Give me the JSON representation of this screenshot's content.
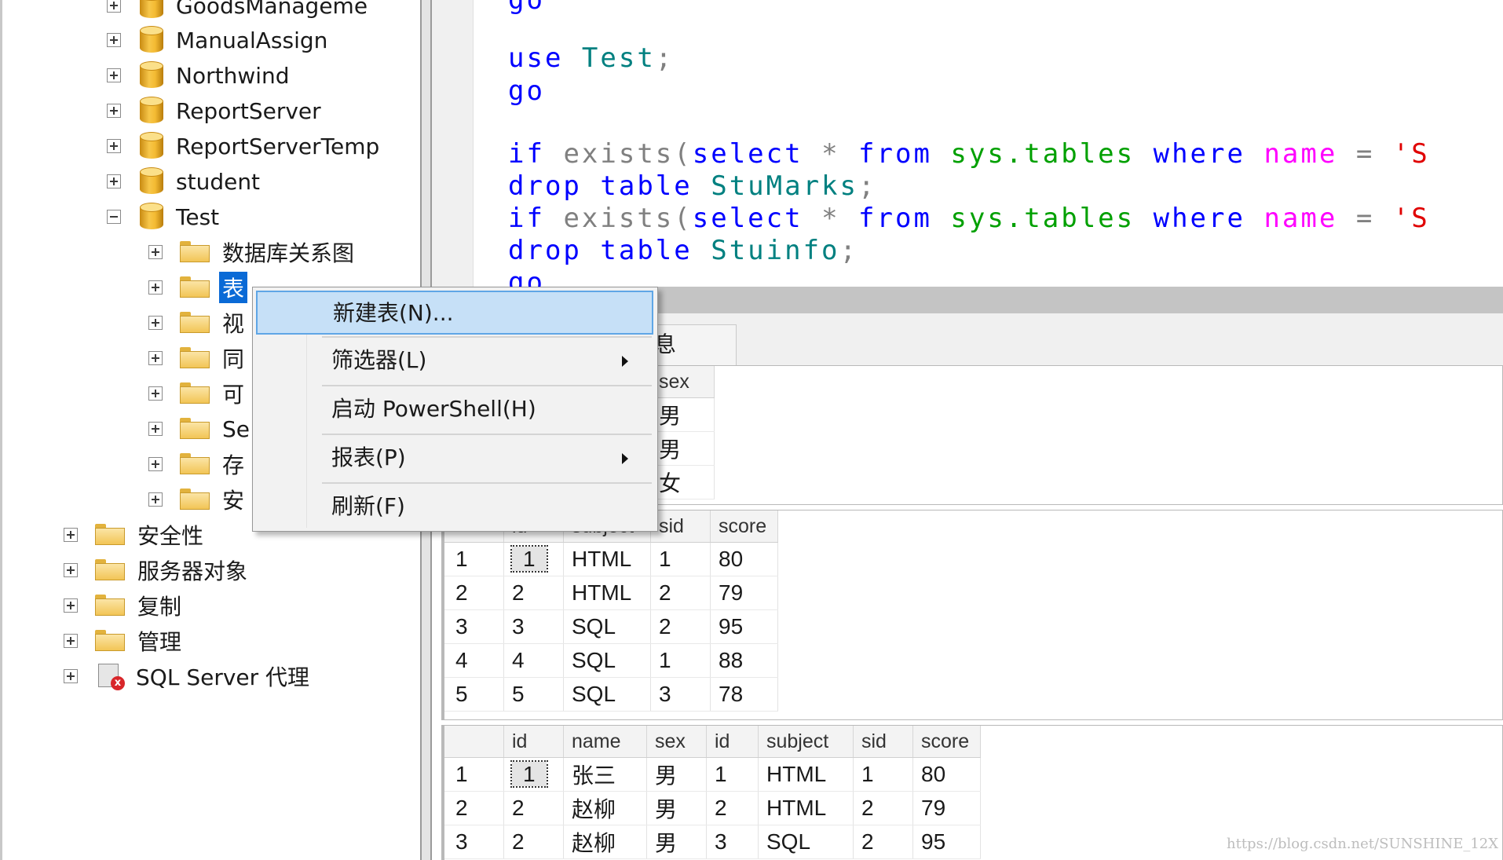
{
  "object_explorer": {
    "databases": [
      {
        "label": "GoodsManageme",
        "expanded": false
      },
      {
        "label": "ManualAssign",
        "expanded": false
      },
      {
        "label": "Northwind",
        "expanded": false
      },
      {
        "label": "ReportServer",
        "expanded": false
      },
      {
        "label": "ReportServerTemp",
        "expanded": false
      },
      {
        "label": "student",
        "expanded": false
      },
      {
        "label": "Test",
        "expanded": true
      }
    ],
    "test_children": [
      {
        "label": "数据库关系图"
      },
      {
        "label": "表",
        "selected": true
      },
      {
        "label": "视"
      },
      {
        "label": "同"
      },
      {
        "label": "可"
      },
      {
        "label": "Se"
      },
      {
        "label": "存"
      },
      {
        "label": "安"
      }
    ],
    "server_nodes": [
      {
        "label": "安全性"
      },
      {
        "label": "服务器对象"
      },
      {
        "label": "复制"
      },
      {
        "label": "管理"
      },
      {
        "label": "SQL Server 代理",
        "icon": "sql-agent-stopped-icon"
      }
    ]
  },
  "editor": {
    "line_go_top": "go",
    "use_kw": "use",
    "use_db": "Test",
    "semicolon": ";",
    "go": "go",
    "if_kw": "if",
    "exists_fn": "exists",
    "paren_open": "(",
    "select_kw": "select",
    "star": "*",
    "from_kw": "from",
    "sys_tables": "sys.tables",
    "where_kw": "where",
    "name_col": "name",
    "eq": "=",
    "quote": "'S",
    "drop_kw": "drop",
    "table_kw": "table",
    "table1": "StuMarks",
    "table2": "Stuinfo",
    "go_bottom": "go"
  },
  "results": {
    "messages_tab_fragment": "息",
    "grid1": {
      "columns": [
        "sex"
      ],
      "rows": [
        [
          "男"
        ],
        [
          "男"
        ],
        [
          "女"
        ]
      ]
    },
    "grid2": {
      "columns": [
        "",
        "id",
        "subject",
        "sid",
        "score"
      ],
      "rows": [
        [
          "1",
          "1",
          "HTML",
          "1",
          "80"
        ],
        [
          "2",
          "2",
          "HTML",
          "2",
          "79"
        ],
        [
          "3",
          "3",
          "SQL",
          "2",
          "95"
        ],
        [
          "4",
          "4",
          "SQL",
          "1",
          "88"
        ],
        [
          "5",
          "5",
          "SQL",
          "3",
          "78"
        ]
      ]
    },
    "grid3": {
      "columns": [
        "",
        "id",
        "name",
        "sex",
        "id",
        "subject",
        "sid",
        "score"
      ],
      "rows": [
        [
          "1",
          "1",
          "张三",
          "男",
          "1",
          "HTML",
          "1",
          "80"
        ],
        [
          "2",
          "2",
          "赵柳",
          "男",
          "2",
          "HTML",
          "2",
          "79"
        ],
        [
          "3",
          "2",
          "赵柳",
          "男",
          "3",
          "SQL",
          "2",
          "95"
        ]
      ]
    }
  },
  "context_menu": {
    "items": [
      {
        "label": "新建表(N)...",
        "submenu": false,
        "highlighted": true
      },
      {
        "label": "筛选器(L)",
        "submenu": true
      },
      {
        "label": "启动 PowerShell(H)",
        "submenu": false
      },
      {
        "label": "报表(P)",
        "submenu": true
      },
      {
        "label": "刷新(F)",
        "submenu": false
      }
    ]
  },
  "watermark": "https://blog.csdn.net/SUNSHINE_12X",
  "colors": {
    "keyword": "#0000ff",
    "operator": "#808080",
    "system_object": "#00a000",
    "identifier": "#008080",
    "selection": "#0a6ad6",
    "menu_highlight": "#c6e0f7"
  }
}
